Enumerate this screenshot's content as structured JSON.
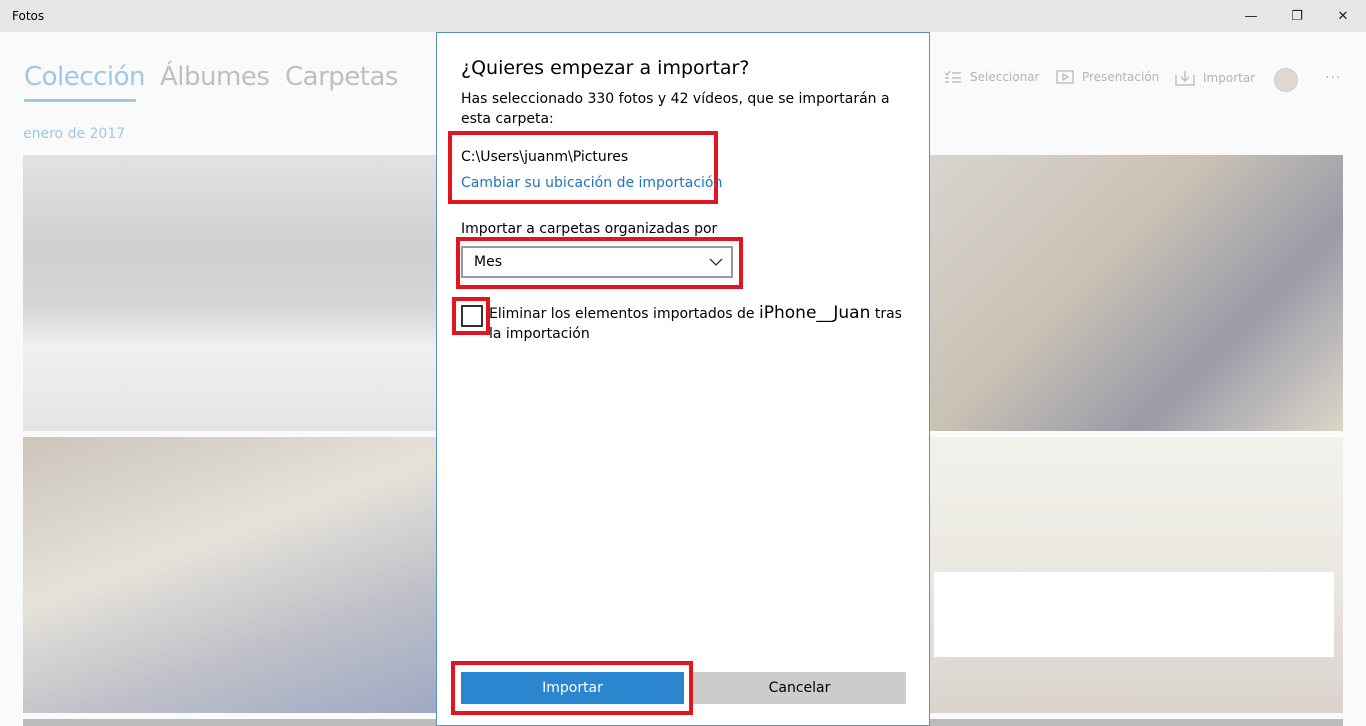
{
  "window": {
    "title": "Fotos",
    "minimize": "—",
    "maximize": "❐",
    "close": "✕"
  },
  "nav": [
    {
      "label": "Colección"
    },
    {
      "label": "Álbumes"
    },
    {
      "label": "Carpetas"
    }
  ],
  "toolbar": {
    "select": "Seleccionar",
    "slideshow": "Presentación",
    "import": "Importar",
    "more": "···"
  },
  "collection": {
    "date": "enero de 2017"
  },
  "dialog": {
    "title": "¿Quieres empezar a importar?",
    "description": "Has seleccionado 330 fotos y 42 vídeos, que se importarán a esta carpeta:",
    "path": "C:\\Users\\juanm\\Pictures",
    "change_location": "Cambiar su ubicación de importación",
    "organize_label": "Importar a carpetas organizadas por",
    "organize_value": "Mes",
    "delete_prefix": "Eliminar los elementos importados de",
    "device_name": "iPhone__Juan",
    "delete_suffix": "tras la importación",
    "delete_checked": false,
    "import_button": "Importar",
    "cancel_button": "Cancelar"
  },
  "colors": {
    "accent": "#2b86d0",
    "link": "#1d74c2",
    "highlight": "#e0151f"
  }
}
